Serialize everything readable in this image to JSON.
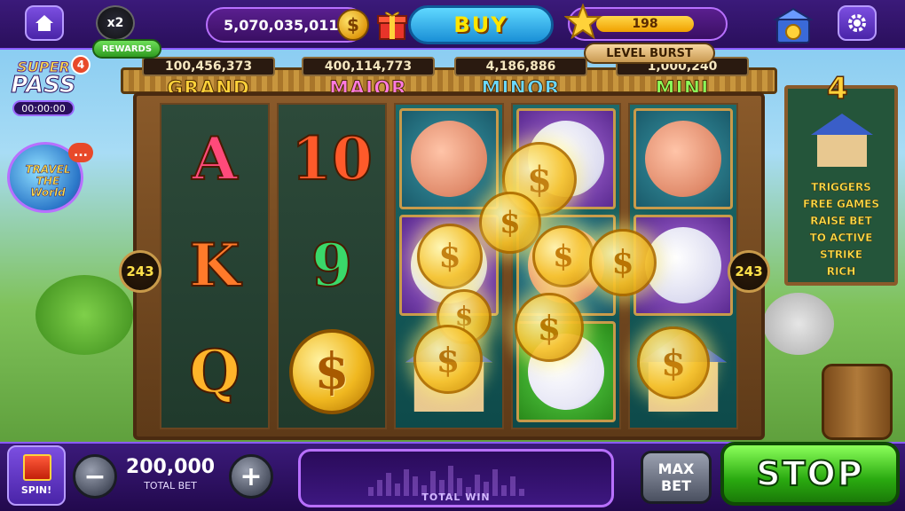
{
  "topbar": {
    "multiplier": "x2",
    "rewards_label": "REWARDS",
    "balance": "5,070,035,011",
    "buy_label": "BUY",
    "level": "198",
    "level_burst": "LEVEL BURST"
  },
  "jackpots": [
    {
      "value": "100,456,373",
      "label": "GRAND",
      "color": "#ffd23a"
    },
    {
      "value": "400,114,773",
      "label": "MAJOR",
      "color": "#ff7ae0"
    },
    {
      "value": "4,186,886",
      "label": "MINOR",
      "color": "#6ad8ff"
    },
    {
      "value": "1,000,240",
      "label": "MINI",
      "color": "#8aff5a"
    }
  ],
  "super_pass": {
    "top": "SUPER",
    "main": "PASS",
    "timer": "00:00:00",
    "count": "4"
  },
  "travel": {
    "title": "TRAVEL THE World",
    "more": "..."
  },
  "reels": {
    "ways_left": "243",
    "ways_right": "243",
    "letters": {
      "a": "A",
      "k": "K",
      "q": "Q",
      "ten": "10",
      "nine": "9"
    },
    "coin_symbol": "$"
  },
  "info_panel": {
    "count": "4",
    "lines": [
      "TRIGGERS",
      "FREE GAMES",
      "RAISE BET",
      "TO ACTIVE",
      "STRIKE",
      "RICH"
    ]
  },
  "bottombar": {
    "spin_label": "SPIN!",
    "bet_amount": "200,000",
    "bet_caption": "TOTAL BET",
    "minus": "−",
    "plus": "+",
    "total_win_label": "TOTAL WIN",
    "max_line1": "MAX",
    "max_line2": "BET",
    "stop_label": "STOP"
  }
}
